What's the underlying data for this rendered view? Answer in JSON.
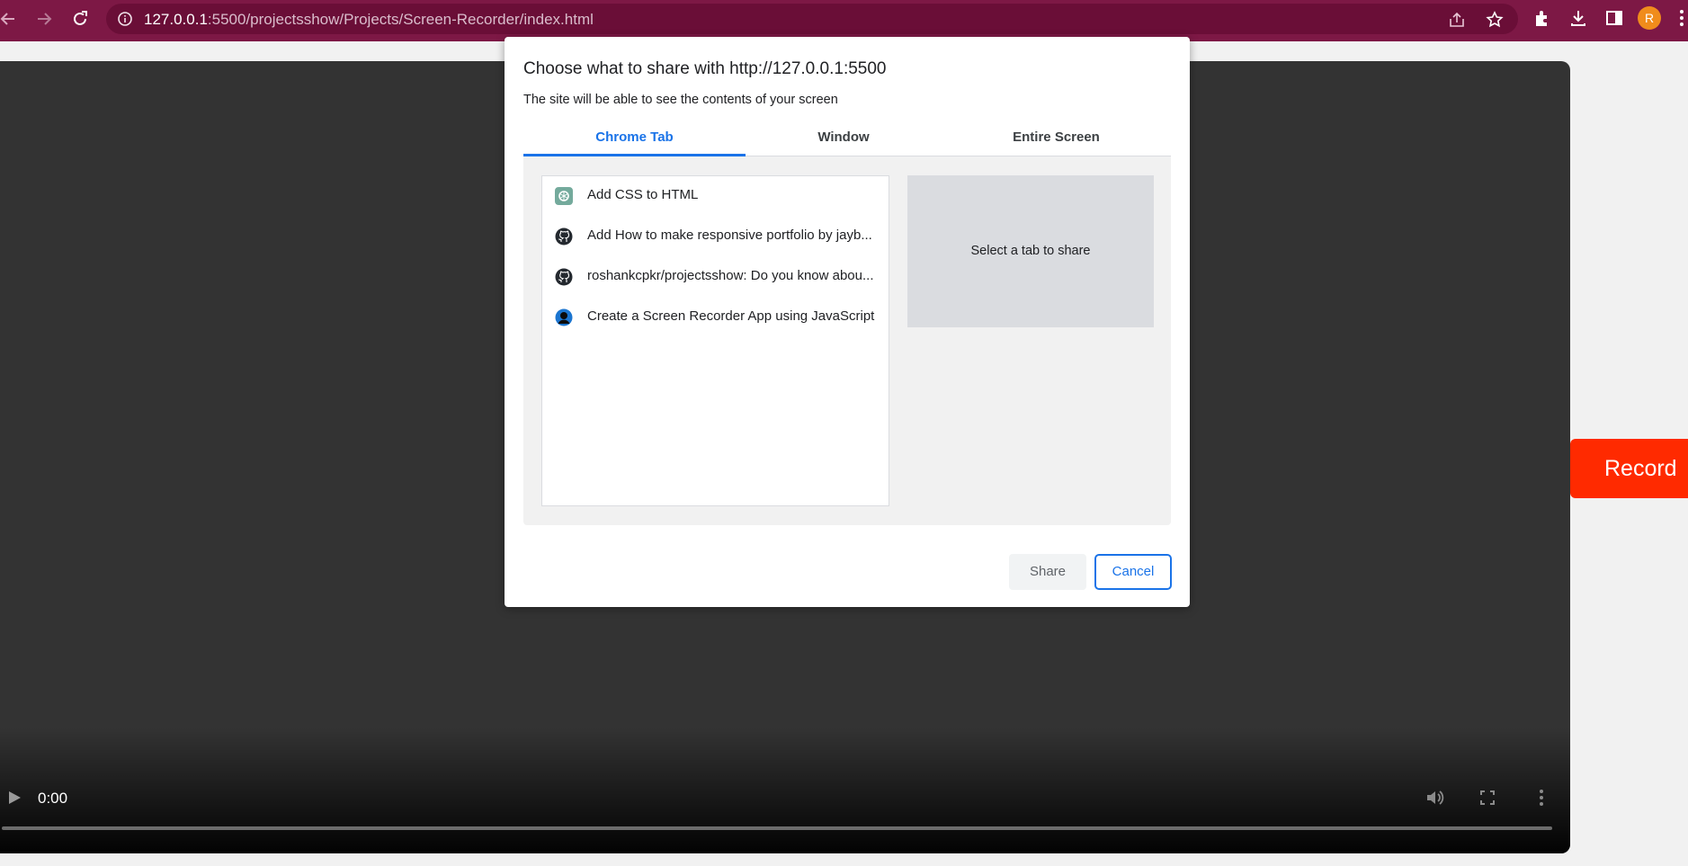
{
  "browser": {
    "url_host": "127.0.0.1",
    "url_rest": ":5500/projectsshow/Projects/Screen-Recorder/index.html",
    "profile_initial": "R",
    "icons": [
      "back-icon",
      "forward-icon",
      "reload-icon",
      "info-icon",
      "share-icon",
      "star-icon",
      "extensions-icon",
      "download-icon",
      "side-panel-icon",
      "more-icon"
    ]
  },
  "dialog": {
    "title": "Choose what to share with http://127.0.0.1:5500",
    "subtitle": "The site will be able to see the contents of your screen",
    "tabs": [
      {
        "label": "Chrome Tab",
        "active": true
      },
      {
        "label": "Window",
        "active": false
      },
      {
        "label": "Entire Screen",
        "active": false
      }
    ],
    "tab_items": [
      {
        "label": "Add CSS to HTML",
        "icon": "chatgpt-icon"
      },
      {
        "label": "Add How to make responsive portfolio by jayb...",
        "icon": "github-icon"
      },
      {
        "label": "roshankcpkr/projectsshow: Do you know abou...",
        "icon": "github-icon"
      },
      {
        "label": "Create a Screen Recorder App using JavaScript",
        "icon": "site-avatar-icon"
      }
    ],
    "preview_text": "Select a tab to share",
    "share_label": "Share",
    "cancel_label": "Cancel"
  },
  "video": {
    "time": "0:00",
    "progress": 0
  },
  "record_label": "Record",
  "colors": {
    "browser_frame": "#7d1845",
    "accent_blue": "#1a73e8",
    "record_red": "#ff2a00",
    "video_bg": "#333333"
  }
}
